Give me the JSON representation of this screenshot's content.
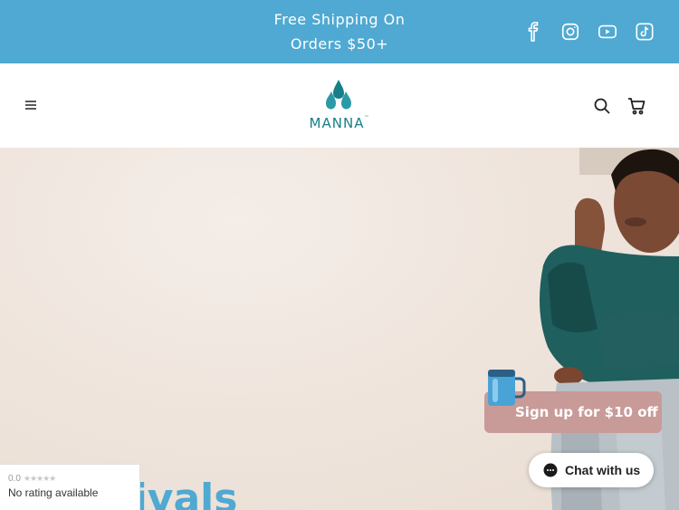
{
  "announcement": {
    "line1": "Free Shipping On",
    "line2": "Orders $50+"
  },
  "social": [
    {
      "name": "facebook-icon"
    },
    {
      "name": "instagram-icon"
    },
    {
      "name": "youtube-icon"
    },
    {
      "name": "tiktok-icon"
    }
  ],
  "header": {
    "logo_text": "MANNA",
    "logo_tm": "™",
    "icons": [
      "menu-icon",
      "search-icon",
      "cart-icon"
    ]
  },
  "hero": {
    "heading_partial": "rivals"
  },
  "popup": {
    "signup_label": "Sign up for $10 off"
  },
  "chat": {
    "label": "Chat with us"
  },
  "rating_widget": {
    "score": "0.0",
    "stars": "★★★★★",
    "text": "No rating available"
  },
  "colors": {
    "announcement_bg": "#4fa9d2",
    "brand_teal": "#177f8a",
    "signup_bg": "#c89a98",
    "hero_bg": "#efe5dd"
  }
}
